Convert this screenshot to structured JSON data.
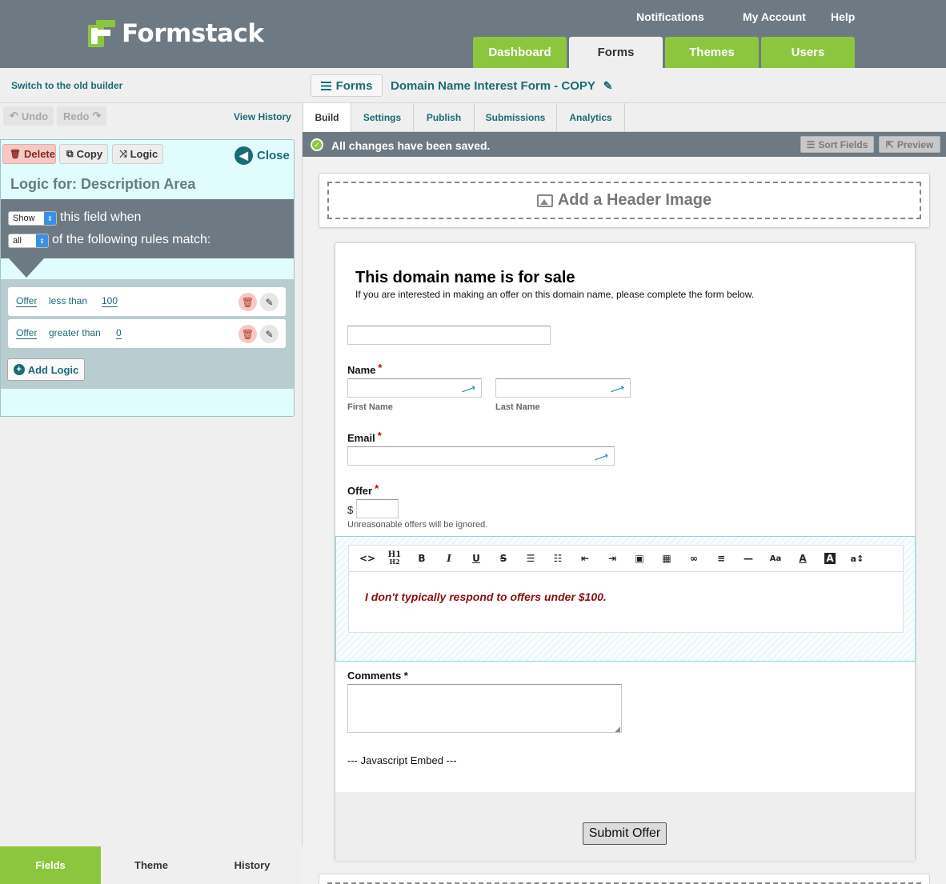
{
  "app": {
    "logo_text": "Formstack",
    "brand_green": "#8cc63f",
    "header_gray": "#6e7a83",
    "teal": "#1b6b74"
  },
  "top_links": [
    "Notifications",
    "My Account",
    "Help"
  ],
  "top_tabs": [
    {
      "label": "Dashboard",
      "active": false
    },
    {
      "label": "Forms",
      "active": true
    },
    {
      "label": "Themes",
      "active": false
    },
    {
      "label": "Users",
      "active": false
    }
  ],
  "subheader": {
    "old_builder": "Switch to the old builder",
    "forms_button": "Forms",
    "form_name": "Domain Name Interest Form - COPY"
  },
  "history_bar": {
    "undo": "Undo",
    "redo": "Redo",
    "view_history": "View History"
  },
  "builder_tabs": [
    {
      "label": "Build",
      "active": true
    },
    {
      "label": "Settings",
      "active": false
    },
    {
      "label": "Publish",
      "active": false
    },
    {
      "label": "Submissions",
      "active": false
    },
    {
      "label": "Analytics",
      "active": false
    }
  ],
  "logic_panel": {
    "delete": "Delete",
    "copy": "Copy",
    "logic": "Logic",
    "close": "Close",
    "title": "Logic for: Description Area",
    "action_select": "Show",
    "action_text": "this field when",
    "match_select": "all",
    "match_text": "of the following rules match:",
    "conditions": [
      {
        "field": "Offer",
        "operator": "less than",
        "value": "100"
      },
      {
        "field": "Offer",
        "operator": "greater than",
        "value": "0"
      }
    ],
    "add_logic": "Add Logic"
  },
  "bottom_tabs": [
    {
      "label": "Fields",
      "active": true
    },
    {
      "label": "Theme",
      "active": false
    },
    {
      "label": "History",
      "active": false
    }
  ],
  "status": {
    "message": "All changes have been saved.",
    "sort_fields": "Sort Fields",
    "preview": "Preview"
  },
  "header_image": {
    "label": "Add a Header Image"
  },
  "form": {
    "title": "This domain name is for sale",
    "description": "If you are interested in making an offer on this domain name, please complete the form below.",
    "name_label": "Name",
    "first_name": "First Name",
    "last_name": "Last Name",
    "email_label": "Email",
    "offer_label": "Offer",
    "currency": "$",
    "offer_hint": "Unreasonable offers will be ignored.",
    "editor_text": "I don't typically respond to offers under $100.",
    "comments_label": "Comments *",
    "js_embed": "--- Javascript Embed ---",
    "submit": "Submit Offer"
  },
  "editor_toolbar": [
    "<>",
    "H1/H2",
    "B",
    "I",
    "U",
    "S",
    "ul",
    "ol",
    "outdent",
    "indent",
    "image",
    "table",
    "link",
    "align",
    "hr",
    "Aa",
    "A",
    "A-bg",
    "a↕"
  ]
}
